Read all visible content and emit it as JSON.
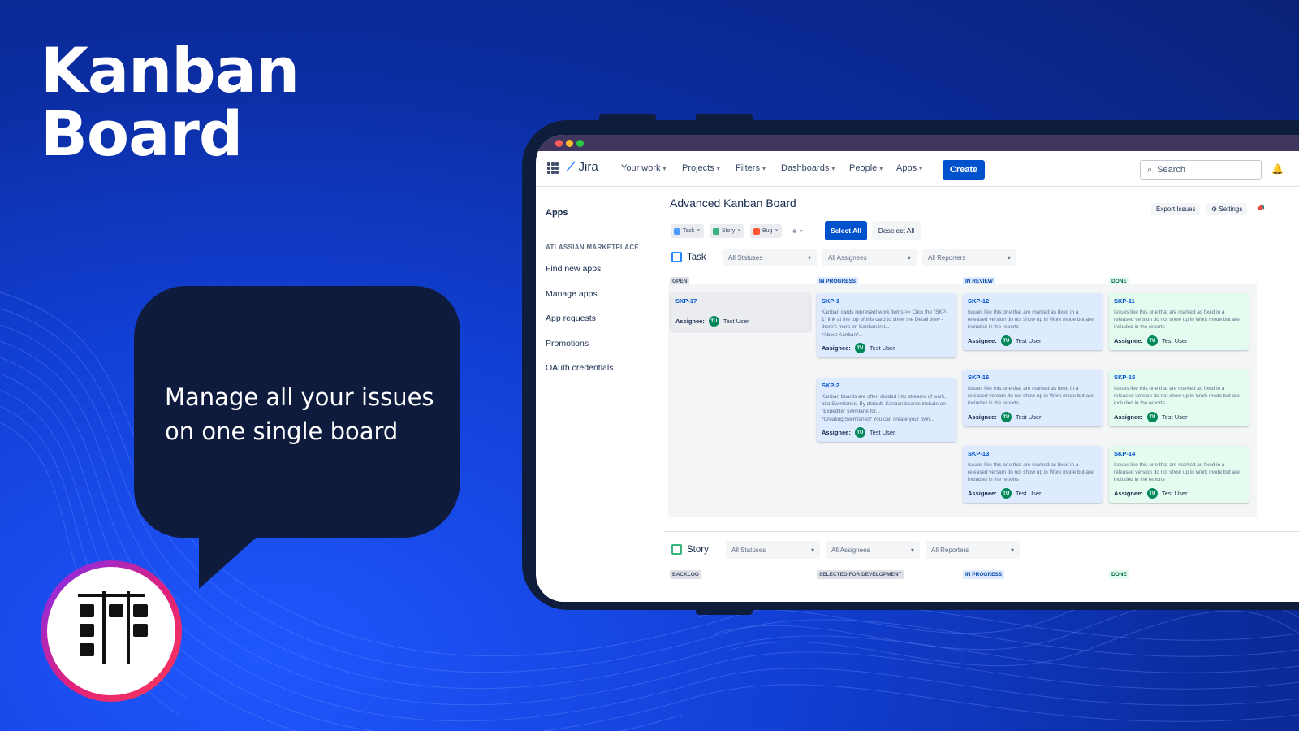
{
  "hero": {
    "title_line1": "Kanban",
    "title_line2": "Board",
    "tagline": "Manage all your issues on one single board"
  },
  "colors": {
    "accent": "#0052cc",
    "background": "#1240d6",
    "bubble": "#0f1b3d"
  },
  "jira": {
    "logo_text": "Jira",
    "nav": [
      {
        "label": "Your work"
      },
      {
        "label": "Projects"
      },
      {
        "label": "Filters"
      },
      {
        "label": "Dashboards"
      },
      {
        "label": "People"
      },
      {
        "label": "Apps"
      }
    ],
    "create_label": "Create",
    "search_placeholder": "Search"
  },
  "sidebar": {
    "heading": "Apps",
    "category": "ATLASSIAN MARKETPLACE",
    "items": [
      "Find new apps",
      "Manage apps",
      "App requests",
      "Promotions",
      "OAuth credentials"
    ]
  },
  "board": {
    "title": "Advanced Kanban Board",
    "export_label": "Export Issues",
    "settings_label": "Settings",
    "filters": [
      "Task",
      "Story",
      "Bug"
    ],
    "select_all": "Select All",
    "deselect_all": "Deselect All",
    "dropdowns": {
      "statuses": "All Statuses",
      "assignees": "All Assignees",
      "reporters": "All Reporters"
    },
    "assignee_label": "Assignee:",
    "assignee_name": "Test User",
    "assignee_initials": "TU",
    "task": {
      "label": "Task",
      "columns": [
        "OPEN",
        "IN PROGRESS",
        "IN REVIEW",
        "DONE"
      ],
      "cards": {
        "skp17": {
          "key": "SKP-17"
        },
        "skp1": {
          "key": "SKP-1",
          "desc": "Kanban cards represent work items >> Click the \"SKP-1\" link at the top of this card to show the Detail view - there's more on Kanban in t...",
          "extra": "*About Kanban*..."
        },
        "skp2": {
          "key": "SKP-2",
          "desc": "Kanban boards are often divided into streams of work, aka Swimlanes. By default, Kanban boards include an \"Expedite\" swimlane for...",
          "extra": "*Creating Swimlanes* You can create your own..."
        },
        "skp12": {
          "key": "SKP-12",
          "desc": "Issues like this one that are marked as fixed in a released version do not show up in Work mode but are included in the reports"
        },
        "skp16": {
          "key": "SKP-16",
          "desc": "Issues like this one that are marked as fixed in a released version do not show up in Work mode but are included in the reports"
        },
        "skp13": {
          "key": "SKP-13",
          "desc": "Issues like this one that are marked as fixed in a released version do not show up in Work mode but are included in the reports"
        },
        "skp11": {
          "key": "SKP-11",
          "desc": "Issues like this one that are marked as fixed in a released version do not show up in Work mode but are included in the reports"
        },
        "skp15": {
          "key": "SKP-15",
          "desc": "Issues like this one that are marked as fixed in a released version do not show up in Work mode but are included in the reports"
        },
        "skp14": {
          "key": "SKP-14",
          "desc": "Issues like this one that are marked as fixed in a released version do not show up in Work mode but are included in the reports"
        }
      }
    },
    "story": {
      "label": "Story",
      "columns": [
        "BACKLOG",
        "SELECTED FOR DEVELOPMENT",
        "IN PROGRESS",
        "DONE"
      ]
    }
  }
}
